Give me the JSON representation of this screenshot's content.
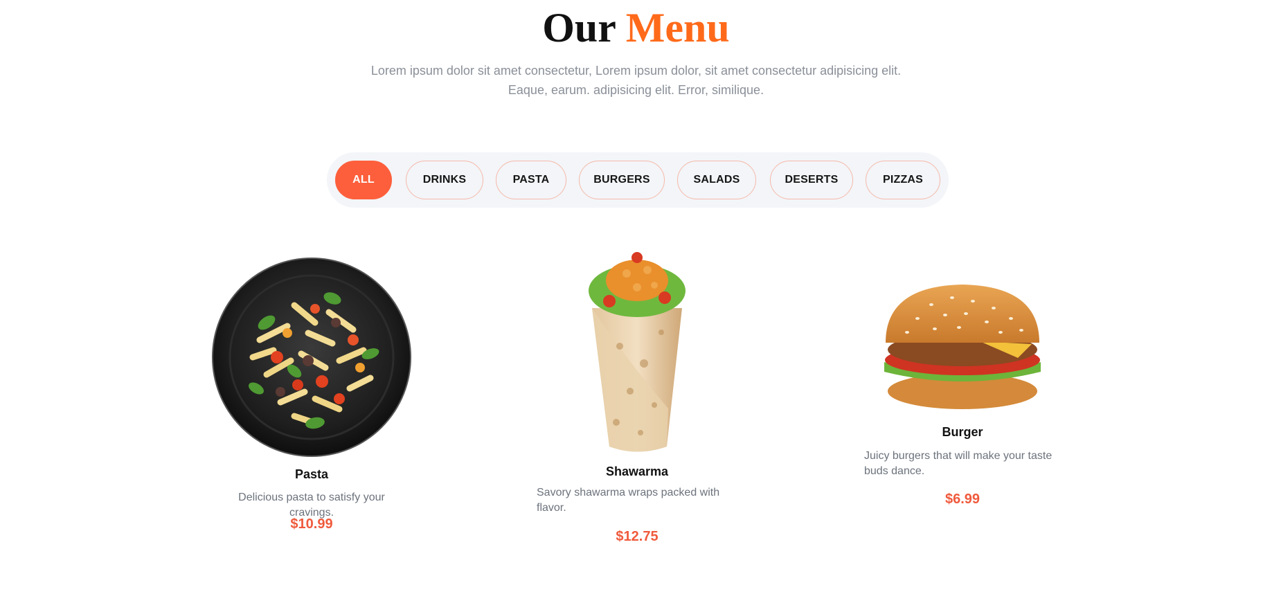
{
  "section": {
    "title_word_1": "Our",
    "title_word_2": "Menu",
    "intro_line_1": "Lorem ipsum dolor sit amet consectetur, Lorem ipsum dolor, sit amet consectetur adipisicing elit.",
    "intro_line_2": "Eaque, earum. adipisicing elit. Error, similique."
  },
  "filters": [
    {
      "label": "ALL",
      "active": true
    },
    {
      "label": "DRINKS",
      "active": false
    },
    {
      "label": "PASTA",
      "active": false
    },
    {
      "label": "BURGERS",
      "active": false
    },
    {
      "label": "SALADS",
      "active": false
    },
    {
      "label": "DESERTS",
      "active": false
    },
    {
      "label": "PIZZAS",
      "active": false
    }
  ],
  "menu_items": [
    {
      "name": "Pasta",
      "description": "Delicious pasta to satisfy your cravings.",
      "price": "$10.99",
      "image_icon": "pasta-bowl-image"
    },
    {
      "name": "Shawarma",
      "description": "Savory shawarma wraps packed with flavor.",
      "price": "$12.75",
      "image_icon": "shawarma-wrap-image"
    },
    {
      "name": "Burger",
      "description": "Juicy burgers that will make your taste buds dance.",
      "price": "$6.99",
      "image_icon": "burger-image"
    }
  ],
  "colors": {
    "accent": "#ff6a1a",
    "active_chip": "#fd5f3c",
    "price": "#f05a3c",
    "chip_border": "#f6b8aa",
    "filter_bar_bg": "#f3f5f8",
    "muted_text": "#8a8f98"
  }
}
